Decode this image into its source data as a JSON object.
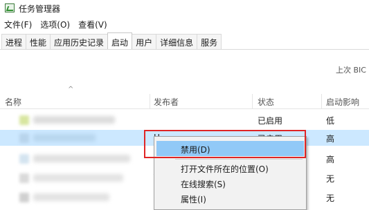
{
  "window": {
    "title": "任务管理器"
  },
  "menu": [
    {
      "label": "文件(F)"
    },
    {
      "label": "选项(O)"
    },
    {
      "label": "查看(V)"
    }
  ],
  "tabs": [
    {
      "label": "进程"
    },
    {
      "label": "性能"
    },
    {
      "label": "应用历史记录"
    },
    {
      "label": "启动",
      "active": true
    },
    {
      "label": "用户"
    },
    {
      "label": "详细信息"
    },
    {
      "label": "服务"
    }
  ],
  "boot_time_label": "上次 BIC",
  "columns": {
    "name": "名称",
    "publisher": "发布者",
    "status": "状态",
    "impact": "启动影响"
  },
  "rows": [
    {
      "publisher": "",
      "status": "已启用",
      "impact": "低"
    },
    {
      "publisher": "H",
      "status": "已启用",
      "impact": "高",
      "selected": true
    },
    {
      "publisher": "",
      "status": "",
      "impact": "高"
    },
    {
      "publisher": "T",
      "status": "",
      "impact": "无"
    },
    {
      "publisher": "N",
      "status": "",
      "impact": "无"
    }
  ],
  "context_menu": {
    "items": [
      {
        "label": "禁用(D)"
      },
      {
        "label": "打开文件所在的位置(O)"
      },
      {
        "label": "在线搜索(S)"
      },
      {
        "label": "属性(I)"
      }
    ]
  },
  "colors": {
    "selected_row": "#cce8ff",
    "menu_hover": "#91c9f7",
    "highlight": "#e02424"
  }
}
